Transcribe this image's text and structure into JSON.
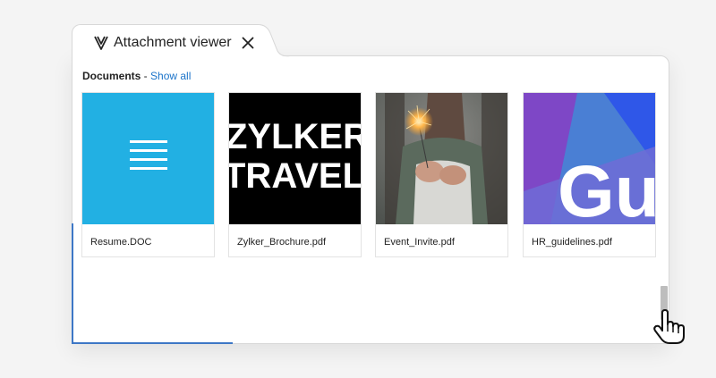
{
  "window": {
    "title": "Attachment viewer",
    "logo_icon": "zoho-v-logo-icon",
    "close_icon": "close-icon"
  },
  "documents": {
    "heading": "Documents",
    "separator": " - ",
    "show_all_label": "Show all",
    "items": [
      {
        "name": "Resume.DOC",
        "thumb": "doc-lines-icon",
        "thumb_color": "#22b0e3"
      },
      {
        "name": "Zylker_Brochure.pdf",
        "thumb_text_1": "ZYLKER",
        "thumb_text_2": "TRAVEL",
        "thumb_color": "#000000"
      },
      {
        "name": "Event_Invite.pdf",
        "thumb": "sparkler-photo"
      },
      {
        "name": "HR_guidelines.pdf",
        "thumb_text": "Gu",
        "thumb_color": "#4a7fd4"
      }
    ]
  },
  "colors": {
    "accent_link": "#1a73c9",
    "doc_blue": "#22b0e3",
    "panel_accent": "#3d77c6"
  },
  "cursor": {
    "icon": "hand-pointer-icon"
  }
}
